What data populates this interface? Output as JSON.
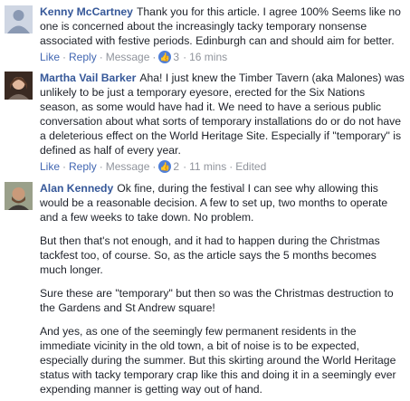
{
  "comments": [
    {
      "author": "Kenny McCartney",
      "paragraphs": [
        "Thank you for this article. I agree 100% Seems like no one is concerned about the increasingly tacky temporary nonsense associated with festive periods. Edinburgh can and should aim for better."
      ],
      "actions": {
        "like": "Like",
        "reply": "Reply",
        "message": "Message",
        "likes": "3",
        "time": "16 mins",
        "edited": ""
      }
    },
    {
      "author": "Martha Vail Barker",
      "paragraphs": [
        "Aha! I just knew the Timber Tavern (aka Malones) was unlikely to be just a temporary eyesore, erected for the Six Nations season, as some would have had it. We need to have a serious public conversation about what sorts of temporary installations do or do not have a deleterious effect on the World Heritage Site. Especially if \"temporary\" is defined as half of every year."
      ],
      "actions": {
        "like": "Like",
        "reply": "Reply",
        "message": "Message",
        "likes": "2",
        "time": "11 mins",
        "edited": "Edited"
      }
    },
    {
      "author": "Alan Kennedy",
      "paragraphs": [
        "Ok fine, during the festival I can see why allowing this would be a reasonable decision. A few to set up, two months to operate and a few weeks to take down. No problem.",
        "But then that's not enough, and it had to happen during the Christmas tackfest too, of course. So, as the article says the 5 months becomes much longer.",
        "Sure these are \"temporary\" but then so was the Christmas destruction to the Gardens and St Andrew square!",
        "And yes, as one of the seemingly few permanent residents in the immediate vicinity in the old town, a bit of noise is to be expected, especially during the summer. But this skirting around the World Heritage status with tacky temporary crap like this and doing it in a seemingly ever expending manner is getting way out of hand."
      ]
    }
  ],
  "colors": {
    "link": "#365899",
    "action": "#4267b2",
    "meta": "#90949c",
    "like_badge": "#4f7fd8"
  }
}
